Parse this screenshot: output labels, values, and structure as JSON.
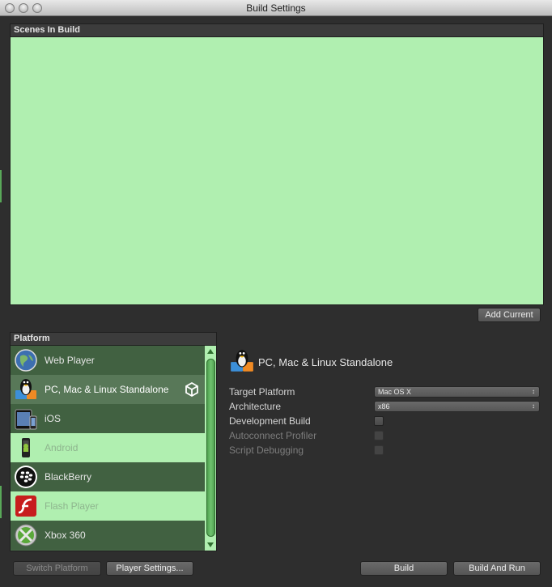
{
  "window": {
    "title": "Build Settings"
  },
  "scenes": {
    "header": "Scenes In Build",
    "add_current_label": "Add Current"
  },
  "platform": {
    "header": "Platform",
    "items": [
      {
        "label": "Web Player",
        "icon": "globe-icon"
      },
      {
        "label": "PC, Mac & Linux Standalone",
        "icon": "penguin-icon"
      },
      {
        "label": "iOS",
        "icon": "tablet-icon"
      },
      {
        "label": "Android",
        "icon": "android-robot-icon"
      },
      {
        "label": "BlackBerry",
        "icon": "blackberry-icon"
      },
      {
        "label": "Flash Player",
        "icon": "flash-icon"
      },
      {
        "label": "Xbox 360",
        "icon": "xbox-icon"
      }
    ],
    "selected_index": 1
  },
  "settings": {
    "title": "PC, Mac & Linux Standalone",
    "target_platform_label": "Target Platform",
    "target_platform_value": "Mac OS X",
    "architecture_label": "Architecture",
    "architecture_value": "x86",
    "development_build_label": "Development Build",
    "autoconnect_profiler_label": "Autoconnect Profiler",
    "script_debugging_label": "Script Debugging"
  },
  "buttons": {
    "switch_platform": "Switch Platform",
    "player_settings": "Player Settings...",
    "build": "Build",
    "build_and_run": "Build And Run"
  },
  "colors": {
    "list_green": "#b0efb0",
    "row_dark": "#416141",
    "panel_bg": "#2e2e2e"
  }
}
